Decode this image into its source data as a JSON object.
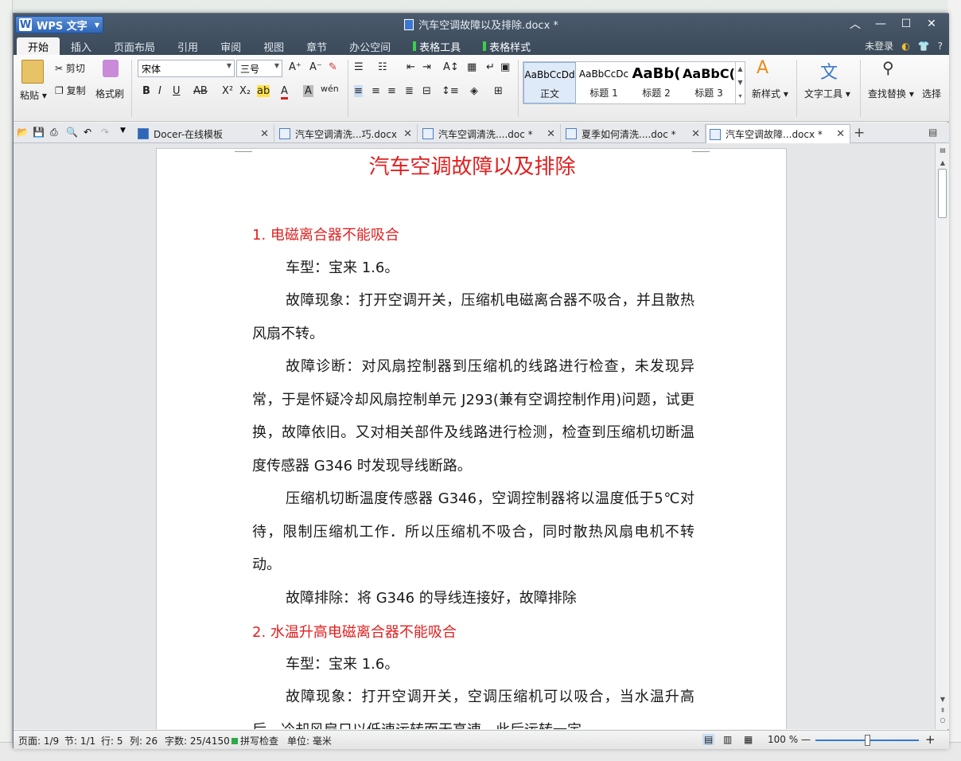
{
  "background": {
    "accent": "#2e7bd6"
  },
  "titlebar": {
    "app_name": "WPS 文字",
    "doc_title": "汽车空调故障以及排除.docx *",
    "tabs": [
      {
        "label": "开始"
      },
      {
        "label": "插入"
      },
      {
        "label": "页面布局"
      },
      {
        "label": "引用"
      },
      {
        "label": "审阅"
      },
      {
        "label": "视图"
      },
      {
        "label": "章节"
      },
      {
        "label": "办公空间"
      },
      {
        "label": "表格工具"
      },
      {
        "label": "表格样式"
      }
    ],
    "user": "未登录",
    "help": "?"
  },
  "ribbon": {
    "paste": "粘贴",
    "cut": "剪切",
    "copy": "复制",
    "format_painter": "格式刷",
    "font_name": "宋体",
    "font_size": "三号",
    "styles": [
      {
        "sample": "AaBbCcDd",
        "label": "正文"
      },
      {
        "sample": "AaBbCcDc",
        "label": "标题 1"
      },
      {
        "sample": "AaBb(",
        "label": "标题 2"
      },
      {
        "sample": "AaBbC(",
        "label": "标题 3"
      }
    ],
    "new_style": "新样式",
    "text_tools": "文字工具",
    "find_replace": "查找替换",
    "select": "选择"
  },
  "doc_tabs": [
    {
      "label": "Docer-在线模板"
    },
    {
      "label": "汽车空调清洗...巧.docx"
    },
    {
      "label": "汽车空调清洗....doc *"
    },
    {
      "label": "夏季如何清洗....doc *"
    },
    {
      "label": "汽车空调故障...docx *"
    }
  ],
  "document": {
    "title": "汽车空调故障以及排除",
    "section1_heading": "1.  电磁离合器不能吸合",
    "s1_p1": "车型：宝来 1.6。",
    "s1_p2": "故障现象：打开空调开关，压缩机电磁离合器不吸合，并且散热风扇不转。",
    "s1_p3": "故障诊断：对风扇控制器到压缩机的线路进行检查，未发现异常，于是怀疑冷却风扇控制单元 J293(兼有空调控制作用)问题，试更换，故障依旧。又对相关部件及线路进行检测，检查到压缩机切断温度传感器 G346 时发现导线断路。",
    "s1_p4": "压缩机切断温度传感器 G346，空调控制器将以温度低于5℃对待，限制压缩机工作．所以压缩机不吸合，同时散热风扇电机不转动。",
    "s1_p5": "故障排除：将 G346 的导线连接好，故障排除",
    "section2_heading": "2.  水温升高电磁离合器不能吸合",
    "s2_p1": "车型：宝来 1.6。",
    "s2_p2": "故障现象：打开空调开关，空调压缩机可以吸合，当水温升高后，冷却风扇只以低速运转而无高速，此后运转一定"
  },
  "statusbar": {
    "page": "页面: 1/9",
    "section": "节: 1/1",
    "row": "行: 5",
    "col": "列: 26",
    "wordcount": "字数: 25/4150",
    "spellcheck": "拼写检查",
    "unit": "单位: 毫米",
    "zoom": "100 %",
    "zoom_level": 0.5
  }
}
